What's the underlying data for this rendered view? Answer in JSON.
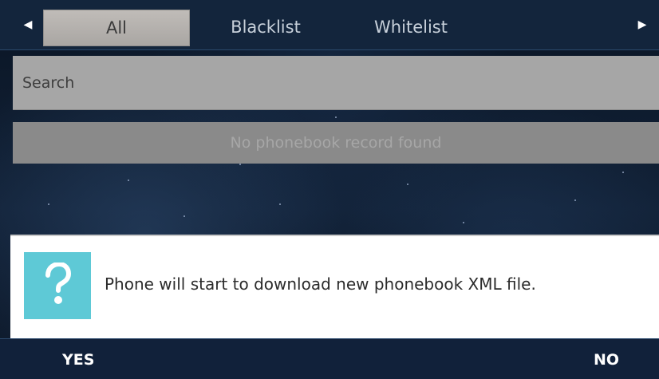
{
  "tabs": {
    "items": [
      "All",
      "Blacklist",
      "Whitelist"
    ],
    "active_index": 0
  },
  "search": {
    "placeholder": "Search"
  },
  "list": {
    "empty_message": "No phonebook record found"
  },
  "dialog": {
    "icon": "question-icon",
    "message": "Phone will start to download new phonebook XML file.",
    "icon_color": "#5ec9d6"
  },
  "softkeys": {
    "yes": "YES",
    "no": "NO"
  }
}
